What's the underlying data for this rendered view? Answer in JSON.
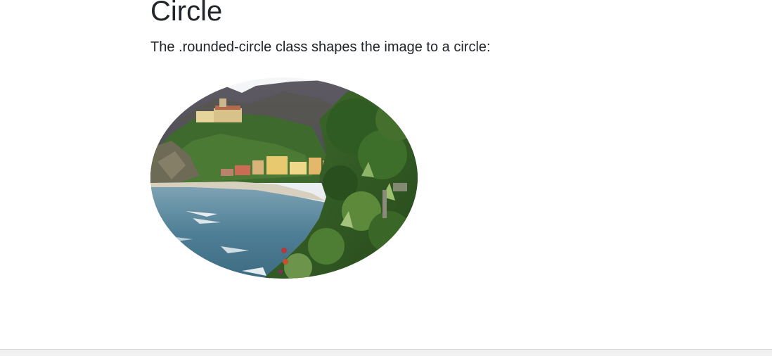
{
  "heading": "Circle",
  "description": "The .rounded-circle class shapes the image to a circle:",
  "image": {
    "alt": "Cinque Terre",
    "subject": "coastal village on hillside above a bay"
  },
  "colors": {
    "text": "#212529",
    "background": "#ffffff"
  }
}
